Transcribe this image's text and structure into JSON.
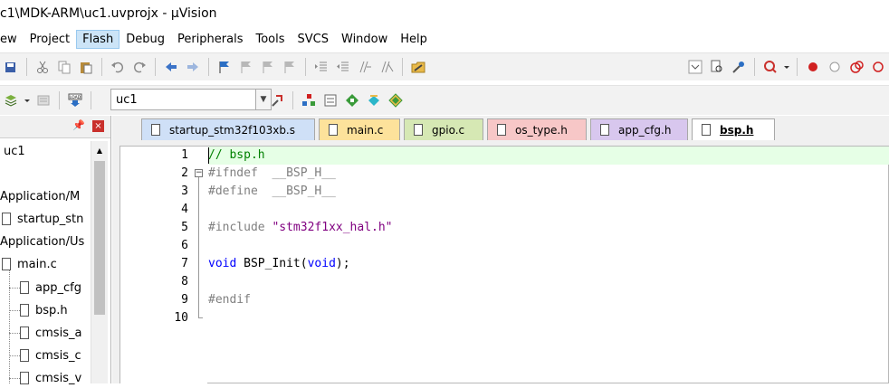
{
  "window": {
    "title": "c1\\MDK-ARM\\uc1.uvprojx - µVision"
  },
  "menu": [
    "ew",
    "Project",
    "Flash",
    "Debug",
    "Peripherals",
    "Tools",
    "SVCS",
    "Window",
    "Help"
  ],
  "toolbar2": {
    "target": "uc1"
  },
  "project_panel": {
    "root": "uc1",
    "items": [
      "Application/M",
      "startup_stn",
      "Application/Us",
      "main.c",
      "app_cfg",
      "bsp.h",
      "cmsis_a",
      "cmsis_c",
      "cmsis_v"
    ]
  },
  "tabs": [
    {
      "label": "startup_stm32f103xb.s",
      "color": "#cfe0f7"
    },
    {
      "label": "main.c",
      "color": "#fde29b"
    },
    {
      "label": "gpio.c",
      "color": "#d6e8b4"
    },
    {
      "label": "os_type.h",
      "color": "#f7c7c7"
    },
    {
      "label": "app_cfg.h",
      "color": "#d8c7ee"
    },
    {
      "label": "bsp.h",
      "color": "#ffffff",
      "active": true
    }
  ],
  "editor": {
    "line_numbers": [
      "1",
      "2",
      "3",
      "4",
      "5",
      "6",
      "7",
      "8",
      "9",
      "10"
    ],
    "lines": [
      [
        {
          "t": "// bsp.h",
          "c": "comment"
        }
      ],
      [
        {
          "t": "#ifndef  __BSP_H__",
          "c": "pre"
        }
      ],
      [
        {
          "t": "#define  __BSP_H__",
          "c": "pre"
        }
      ],
      [],
      [
        {
          "t": "#include ",
          "c": "pre"
        },
        {
          "t": "\"stm32f1xx_hal.h\"",
          "c": "str"
        }
      ],
      [],
      [
        {
          "t": "void",
          "c": "kw"
        },
        {
          "t": " BSP_Init(",
          "c": "plain"
        },
        {
          "t": "void",
          "c": "kw"
        },
        {
          "t": ");",
          "c": "plain"
        }
      ],
      [],
      [
        {
          "t": "#endif",
          "c": "pre"
        }
      ],
      []
    ]
  }
}
